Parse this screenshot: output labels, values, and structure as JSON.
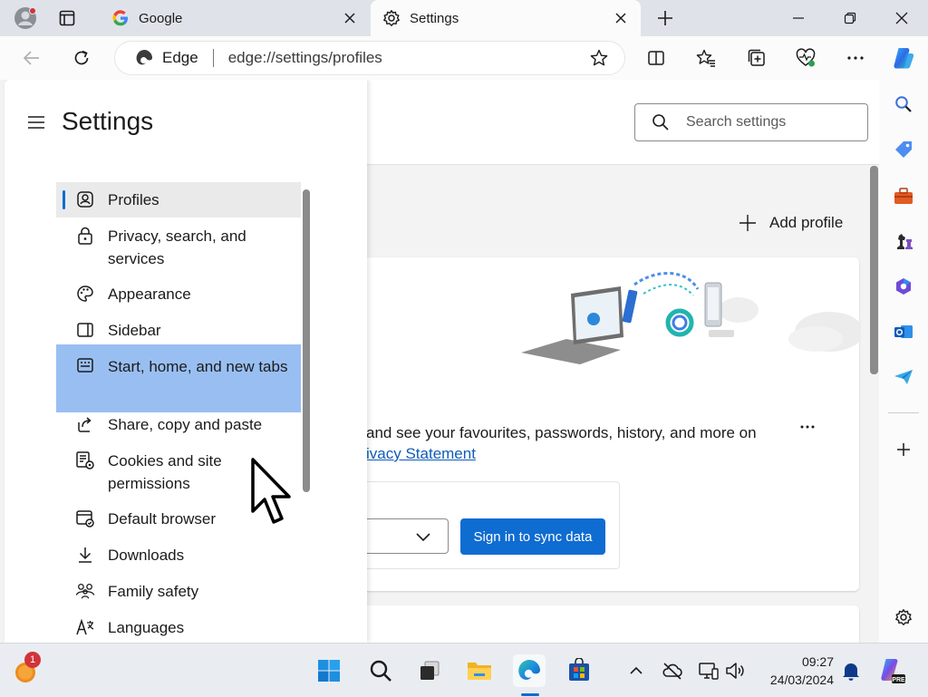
{
  "tabs": [
    {
      "label": "Google",
      "favicon": "google-icon"
    },
    {
      "label": "Settings",
      "favicon": "gear-icon"
    }
  ],
  "addressbar": {
    "site_name": "Edge",
    "url": "edge://settings/profiles"
  },
  "settings": {
    "title": "Settings",
    "search_placeholder": "Search settings",
    "nav": [
      {
        "label": "Profiles",
        "icon": "profiles-icon"
      },
      {
        "label": "Privacy, search, and services",
        "icon": "lock-icon"
      },
      {
        "label": "Appearance",
        "icon": "palette-icon"
      },
      {
        "label": "Sidebar",
        "icon": "sidebar-icon"
      },
      {
        "label": "Start, home, and new tabs",
        "icon": "home-tabs-icon"
      },
      {
        "label": "Share, copy and paste",
        "icon": "share-icon"
      },
      {
        "label": "Cookies and site permissions",
        "icon": "cookies-icon"
      },
      {
        "label": "Default browser",
        "icon": "default-browser-icon"
      },
      {
        "label": "Downloads",
        "icon": "download-icon"
      },
      {
        "label": "Family safety",
        "icon": "family-icon"
      },
      {
        "label": "Languages",
        "icon": "languages-icon"
      }
    ],
    "active_item": "Profiles",
    "hovered_item": "Start, home, and new tabs"
  },
  "profile": {
    "add_profile": "Add profile",
    "sync_text": "and see your favourites, passwords, history, and more on",
    "privacy_link": "ivacy Statement",
    "sign_in_button": "Sign in to sync data"
  },
  "taskbar": {
    "notification_count": "1",
    "time": "09:27",
    "date": "24/03/2024"
  },
  "colors": {
    "accent": "#0f6cd1",
    "hover_highlight": "#99bff2"
  }
}
